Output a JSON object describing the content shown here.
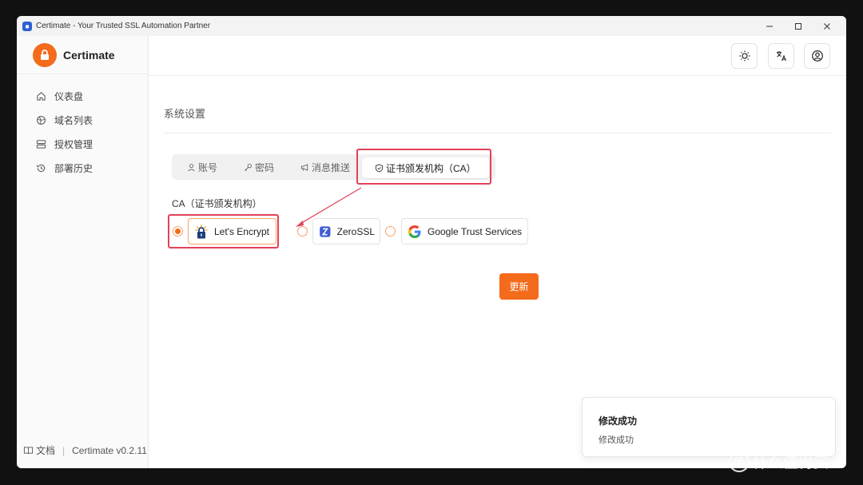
{
  "window": {
    "title": "Certimate - Your Trusted SSL Automation Partner"
  },
  "brand": {
    "name": "Certimate",
    "accent": "#f46b1b"
  },
  "sidebar": {
    "items": [
      {
        "label": "仪表盘",
        "icon": "home-icon"
      },
      {
        "label": "域名列表",
        "icon": "globe-icon"
      },
      {
        "label": "授权管理",
        "icon": "server-icon"
      },
      {
        "label": "部署历史",
        "icon": "history-icon"
      }
    ],
    "footer": {
      "docs": "文档",
      "version": "Certimate v0.2.11"
    }
  },
  "topbar": {
    "icons": [
      "theme-toggle-icon",
      "language-icon",
      "user-account-icon"
    ]
  },
  "main": {
    "title": "系统设置",
    "tabs": [
      {
        "label": "账号",
        "icon": "user-icon"
      },
      {
        "label": "密码",
        "icon": "key-icon"
      },
      {
        "label": "消息推送",
        "icon": "megaphone-icon"
      },
      {
        "label": "证书颁发机构（CA）",
        "icon": "shield-icon",
        "active": true
      }
    ],
    "ca_label": "CA（证书颁发机构）",
    "options": [
      {
        "label": "Let's Encrypt",
        "selected": true
      },
      {
        "label": "ZeroSSL",
        "selected": false
      },
      {
        "label": "Google Trust Services",
        "selected": false
      }
    ],
    "update_button": "更新"
  },
  "toast": {
    "title": "修改成功",
    "message": "修改成功"
  },
  "watermark": {
    "circle": "值",
    "text": "什么值得买"
  }
}
